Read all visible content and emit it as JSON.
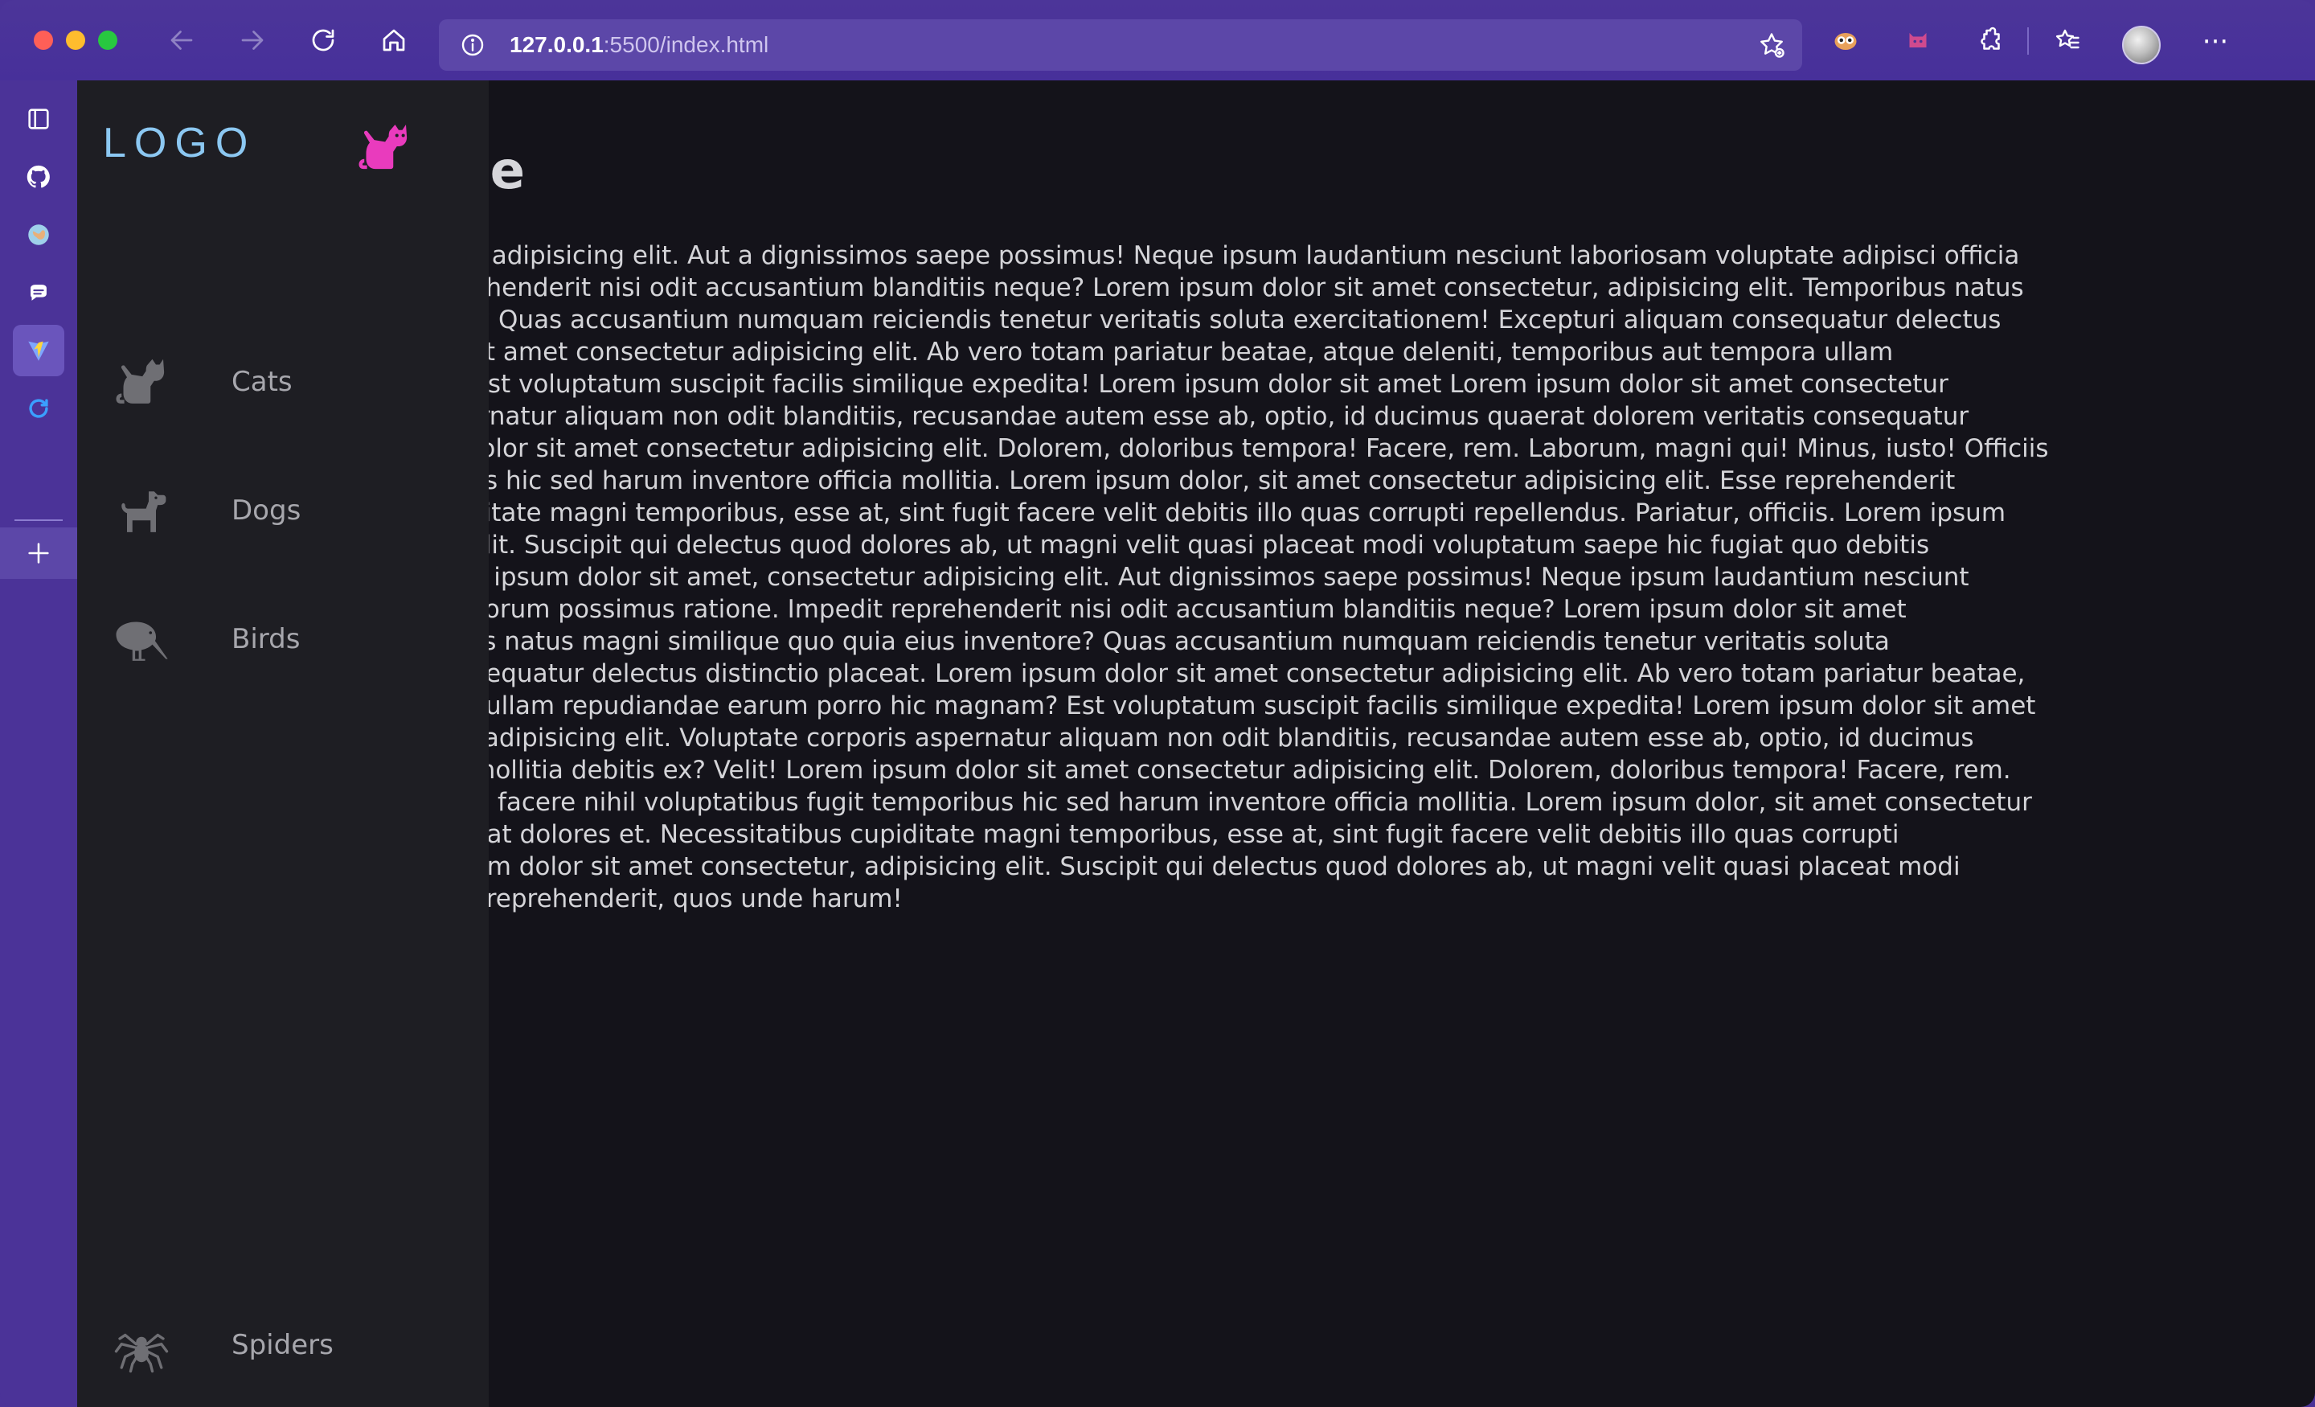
{
  "browser": {
    "url_host": "127.0.0.1",
    "url_rest": ":5500/index.html",
    "colors": {
      "chrome": "#4b3398",
      "urlbar": "#5c47a8"
    },
    "toolbar_icons": [
      "back-icon",
      "forward-icon",
      "reload-icon",
      "home-icon",
      "site-info-icon",
      "favorite-add-icon",
      "owl-extension-icon",
      "cat-extension-icon",
      "puzzle-extensions-icon",
      "favorites-icon",
      "profile-avatar",
      "more-icon"
    ],
    "more_label": "···"
  },
  "sidebar": {
    "icons": [
      "tab-panel-icon",
      "github-icon",
      "globe-icon",
      "chat-icon",
      "vite-icon",
      "refresh-app-icon",
      "add-icon"
    ],
    "add_label": "+"
  },
  "drawer": {
    "logo": "LOGO",
    "colors": {
      "logo": "#8cc8f2",
      "logo_icon": "#e93bbd",
      "nav_icon": "#6f6f74"
    },
    "nav": [
      {
        "label": "Cats",
        "icon": "cat-icon"
      },
      {
        "label": "Dogs",
        "icon": "dog-icon"
      },
      {
        "label": "Birds",
        "icon": "kiwi-bird-icon"
      },
      {
        "label": "Spiders",
        "icon": "spider-icon"
      }
    ]
  },
  "page": {
    "title": "bble",
    "lines": [
      "t amet, consectetur adipisicing elit. Aut a dignissimos saepe possimus! Neque ipsum laudantium nesciunt laboriosam voluptate adipisci officia",
      "tione. Impedit reprehenderit nisi odit accusantium blanditiis neque? Lorem ipsum dolor sit amet consectetur, adipisicing elit. Temporibus natus",
      "quia eius inventore? Quas accusantium numquam reiciendis tenetur veritatis soluta exercitationem! Excepturi aliquam consequatur delectus",
      "orem ipsum dolor sit amet consectetur adipisicing elit. Ab vero totam pariatur beatae, atque deleniti, temporibus aut tempora ullam",
      "orro hic magnam? Est voluptatum suscipit facilis similique expedita! Lorem ipsum dolor sit amet Lorem ipsum dolor sit amet consectetur",
      "ptate corporis aspernatur aliquam non odit blanditiis, recusandae autem esse ab, optio, id ducimus quaerat dolorem veritatis consequatur",
      "elit! Lorem ipsum dolor sit amet consectetur adipisicing elit. Dolorem, doloribus tempora! Facere, rem. Laborum, magni qui! Minus, iusto! Officiis",
      "bus fugit temporibus hic sed harum inventore officia mollitia. Lorem ipsum dolor, sit amet consectetur adipisicing elit. Esse reprehenderit",
      "lecessitatibus cupiditate magni temporibus, esse at, sint fugit facere velit debitis illo quas corrupti repellendus. Pariatur, officiis. Lorem ipsum",
      "ctetur, adipisicing elit. Suscipit qui delectus quod dolores ab, ut magni velit quasi placeat modi voluptatum saepe hic fugiat quo debitis",
      "unde harum! Lorem ipsum dolor sit amet, consectetur adipisicing elit. Aut dignissimos saepe possimus! Neque ipsum laudantium nesciunt",
      "e adipisci officia dolorum possimus ratione. Impedit reprehenderit nisi odit accusantium blanditiis neque? Lorem ipsum dolor sit amet",
      "cing elit. Temporibus natus magni similique quo quia eius inventore? Quas accusantium numquam reiciendis tenetur veritatis soluta",
      "epturi aliquam consequatur delectus distinctio placeat. Lorem ipsum dolor sit amet consectetur adipisicing elit. Ab vero totam pariatur beatae,",
      "oribus aut tempora ullam repudiandae earum porro hic magnam? Est voluptatum suscipit facilis similique expedita! Lorem ipsum dolor sit amet",
      "t amet consectetur adipisicing elit. Voluptate corporis aspernatur aliquam non odit blanditiis, recusandae autem esse ab, optio, id ducimus",
      "itatis consequatur mollitia debitis ex? Velit! Lorem ipsum dolor sit amet consectetur adipisicing elit. Dolorem, doloribus tempora! Facere, rem.",
      " Minus, iusto! Officiis facere nihil voluptatibus fugit temporibus hic sed harum inventore officia mollitia. Lorem ipsum dolor, sit amet consectetur",
      " reprehenderit repellat dolores et. Necessitatibus cupiditate magni temporibus, esse at, sint fugit facere velit debitis illo quas corrupti",
      ", officiis. Lorem ipsum dolor sit amet consectetur, adipisicing elit. Suscipit qui delectus quod dolores ab, ut magni velit quasi placeat modi",
      "c fugiat quo debitis reprehenderit, quos unde harum!"
    ]
  }
}
